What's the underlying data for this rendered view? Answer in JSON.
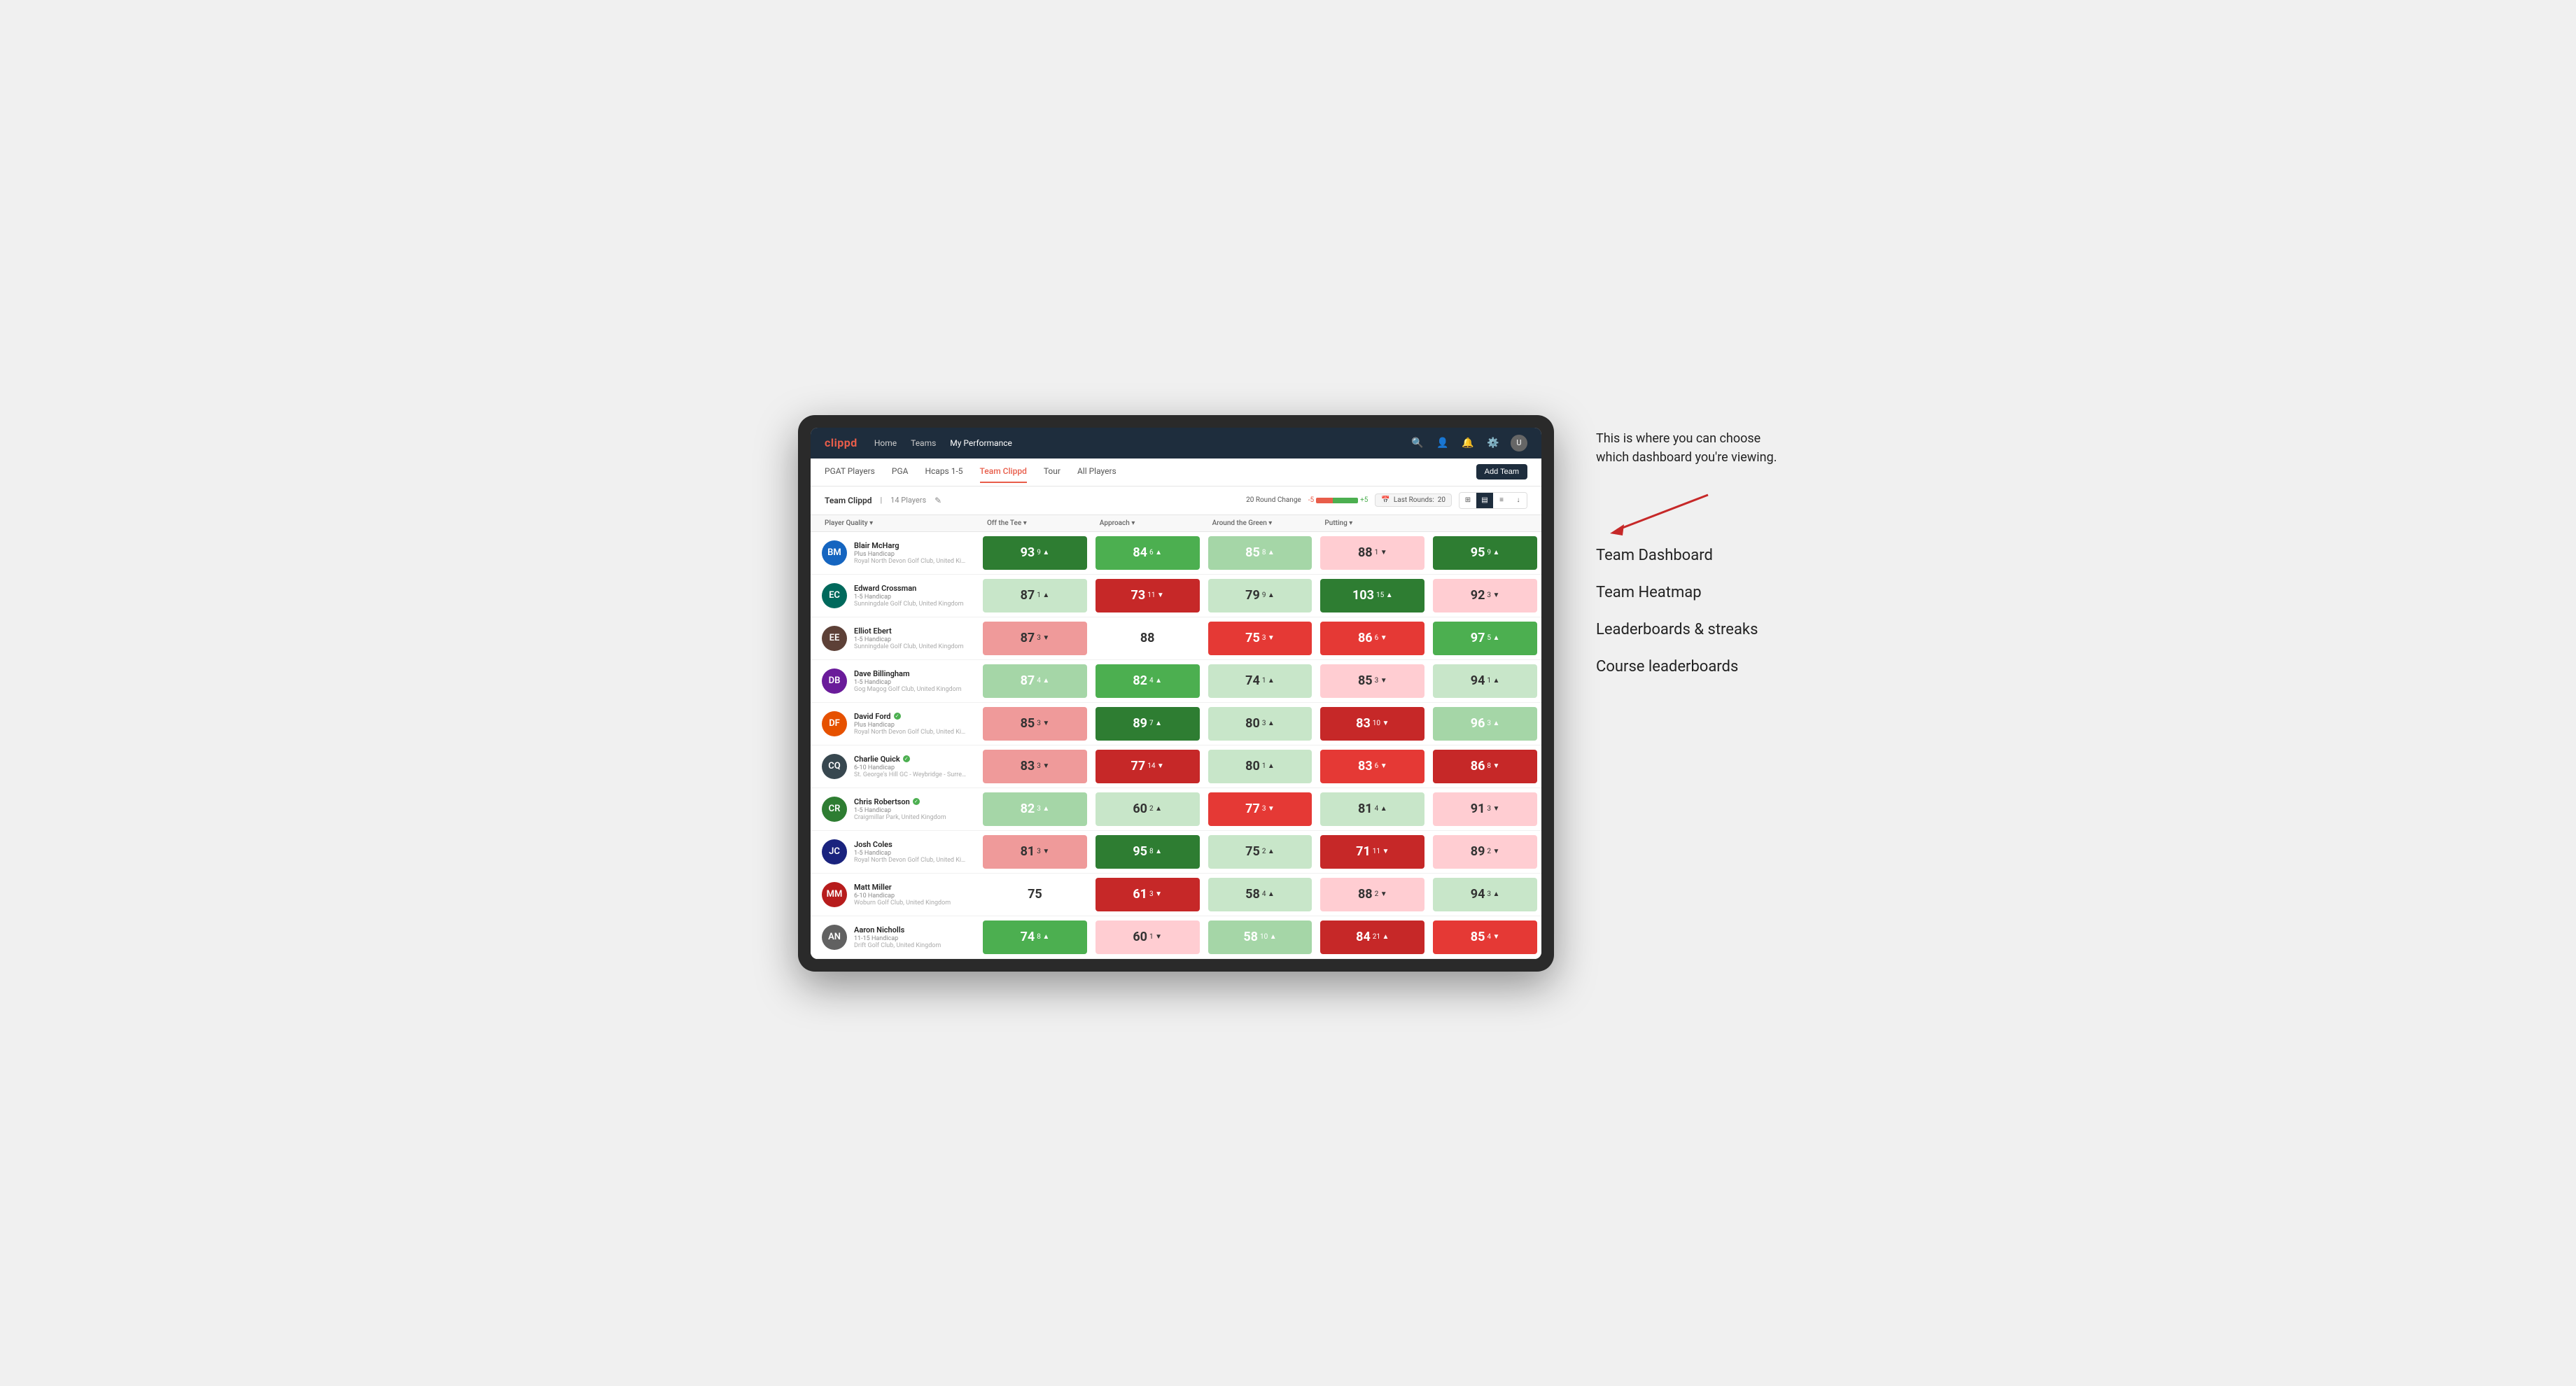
{
  "annotation": {
    "intro": "This is where you can choose which dashboard you're viewing.",
    "arrow": "→"
  },
  "menu": {
    "items": [
      {
        "label": "Team Dashboard"
      },
      {
        "label": "Team Heatmap"
      },
      {
        "label": "Leaderboards & streaks"
      },
      {
        "label": "Course leaderboards"
      }
    ]
  },
  "nav": {
    "logo": "clippd",
    "items": [
      {
        "label": "Home",
        "active": false
      },
      {
        "label": "Teams",
        "active": false
      },
      {
        "label": "My Performance",
        "active": true
      }
    ],
    "add_team": "Add Team"
  },
  "sub_nav": {
    "tabs": [
      {
        "label": "PGAT Players",
        "active": false
      },
      {
        "label": "PGA",
        "active": false
      },
      {
        "label": "Hcaps 1-5",
        "active": false
      },
      {
        "label": "Team Clippd",
        "active": true
      },
      {
        "label": "Tour",
        "active": false
      },
      {
        "label": "All Players",
        "active": false
      }
    ]
  },
  "team_header": {
    "name": "Team Clippd",
    "count": "14 Players",
    "round_change_label": "20 Round Change",
    "neg": "-5",
    "pos": "+5",
    "last_rounds_label": "Last Rounds:",
    "last_rounds_value": "20"
  },
  "table": {
    "headers": [
      {
        "label": "Player Quality ▾"
      },
      {
        "label": "Off the Tee ▾"
      },
      {
        "label": "Approach ▾"
      },
      {
        "label": "Around the Green ▾"
      },
      {
        "label": "Putting ▾"
      }
    ],
    "rows": [
      {
        "name": "Blair McHarg",
        "handicap": "Plus Handicap",
        "club": "Royal North Devon Golf Club, United Kingdom",
        "initials": "BM",
        "av_class": "av-blue",
        "scores": [
          {
            "val": "93",
            "sub": "9",
            "dir": "up",
            "bg": "bg-green-dark"
          },
          {
            "val": "84",
            "sub": "6",
            "dir": "up",
            "bg": "bg-green-med"
          },
          {
            "val": "85",
            "sub": "8",
            "dir": "up",
            "bg": "bg-green-light"
          },
          {
            "val": "88",
            "sub": "1",
            "dir": "down",
            "bg": "bg-very-light-red"
          },
          {
            "val": "95",
            "sub": "9",
            "dir": "up",
            "bg": "bg-green-dark"
          }
        ]
      },
      {
        "name": "Edward Crossman",
        "handicap": "1-5 Handicap",
        "club": "Sunningdale Golf Club, United Kingdom",
        "initials": "EC",
        "av_class": "av-teal",
        "scores": [
          {
            "val": "87",
            "sub": "1",
            "dir": "up",
            "bg": "bg-very-light-green"
          },
          {
            "val": "73",
            "sub": "11",
            "dir": "down",
            "bg": "bg-red-dark"
          },
          {
            "val": "79",
            "sub": "9",
            "dir": "up",
            "bg": "bg-very-light-green"
          },
          {
            "val": "103",
            "sub": "15",
            "dir": "up",
            "bg": "bg-green-dark"
          },
          {
            "val": "92",
            "sub": "3",
            "dir": "down",
            "bg": "bg-very-light-red"
          }
        ]
      },
      {
        "name": "Elliot Ebert",
        "handicap": "1-5 Handicap",
        "club": "Sunningdale Golf Club, United Kingdom",
        "initials": "EE",
        "av_class": "av-brown",
        "scores": [
          {
            "val": "87",
            "sub": "3",
            "dir": "down",
            "bg": "bg-red-light"
          },
          {
            "val": "88",
            "sub": "",
            "dir": "none",
            "bg": "bg-white"
          },
          {
            "val": "75",
            "sub": "3",
            "dir": "down",
            "bg": "bg-red-med"
          },
          {
            "val": "86",
            "sub": "6",
            "dir": "down",
            "bg": "bg-red-med"
          },
          {
            "val": "97",
            "sub": "5",
            "dir": "up",
            "bg": "bg-green-med"
          }
        ]
      },
      {
        "name": "Dave Billingham",
        "handicap": "1-5 Handicap",
        "club": "Gog Magog Golf Club, United Kingdom",
        "initials": "DB",
        "av_class": "av-purple",
        "scores": [
          {
            "val": "87",
            "sub": "4",
            "dir": "up",
            "bg": "bg-green-light"
          },
          {
            "val": "82",
            "sub": "4",
            "dir": "up",
            "bg": "bg-green-med"
          },
          {
            "val": "74",
            "sub": "1",
            "dir": "up",
            "bg": "bg-very-light-green"
          },
          {
            "val": "85",
            "sub": "3",
            "dir": "down",
            "bg": "bg-very-light-red"
          },
          {
            "val": "94",
            "sub": "1",
            "dir": "up",
            "bg": "bg-very-light-green"
          }
        ]
      },
      {
        "name": "David Ford",
        "handicap": "Plus Handicap",
        "club": "Royal North Devon Golf Club, United Kingdom",
        "initials": "DF",
        "av_class": "av-orange",
        "verified": true,
        "scores": [
          {
            "val": "85",
            "sub": "3",
            "dir": "down",
            "bg": "bg-red-light"
          },
          {
            "val": "89",
            "sub": "7",
            "dir": "up",
            "bg": "bg-green-dark"
          },
          {
            "val": "80",
            "sub": "3",
            "dir": "up",
            "bg": "bg-very-light-green"
          },
          {
            "val": "83",
            "sub": "10",
            "dir": "down",
            "bg": "bg-red-dark"
          },
          {
            "val": "96",
            "sub": "3",
            "dir": "up",
            "bg": "bg-green-light"
          }
        ]
      },
      {
        "name": "Charlie Quick",
        "handicap": "6-10 Handicap",
        "club": "St. George's Hill GC - Weybridge - Surrey, Uni...",
        "initials": "CQ",
        "av_class": "av-dark",
        "verified": true,
        "scores": [
          {
            "val": "83",
            "sub": "3",
            "dir": "down",
            "bg": "bg-red-light"
          },
          {
            "val": "77",
            "sub": "14",
            "dir": "down",
            "bg": "bg-red-dark"
          },
          {
            "val": "80",
            "sub": "1",
            "dir": "up",
            "bg": "bg-very-light-green"
          },
          {
            "val": "83",
            "sub": "6",
            "dir": "down",
            "bg": "bg-red-med"
          },
          {
            "val": "86",
            "sub": "8",
            "dir": "down",
            "bg": "bg-red-dark"
          }
        ]
      },
      {
        "name": "Chris Robertson",
        "handicap": "1-5 Handicap",
        "club": "Craigmillar Park, United Kingdom",
        "initials": "CR",
        "av_class": "av-green",
        "verified": true,
        "scores": [
          {
            "val": "82",
            "sub": "3",
            "dir": "up",
            "bg": "bg-green-light"
          },
          {
            "val": "60",
            "sub": "2",
            "dir": "up",
            "bg": "bg-very-light-green"
          },
          {
            "val": "77",
            "sub": "3",
            "dir": "down",
            "bg": "bg-red-med"
          },
          {
            "val": "81",
            "sub": "4",
            "dir": "up",
            "bg": "bg-very-light-green"
          },
          {
            "val": "91",
            "sub": "3",
            "dir": "down",
            "bg": "bg-very-light-red"
          }
        ]
      },
      {
        "name": "Josh Coles",
        "handicap": "1-5 Handicap",
        "club": "Royal North Devon Golf Club, United Kingdom",
        "initials": "JC",
        "av_class": "av-navy",
        "scores": [
          {
            "val": "81",
            "sub": "3",
            "dir": "down",
            "bg": "bg-red-light"
          },
          {
            "val": "95",
            "sub": "8",
            "dir": "up",
            "bg": "bg-green-dark"
          },
          {
            "val": "75",
            "sub": "2",
            "dir": "up",
            "bg": "bg-very-light-green"
          },
          {
            "val": "71",
            "sub": "11",
            "dir": "down",
            "bg": "bg-red-dark"
          },
          {
            "val": "89",
            "sub": "2",
            "dir": "down",
            "bg": "bg-very-light-red"
          }
        ]
      },
      {
        "name": "Matt Miller",
        "handicap": "6-10 Handicap",
        "club": "Woburn Golf Club, United Kingdom",
        "initials": "MM",
        "av_class": "av-red",
        "scores": [
          {
            "val": "75",
            "sub": "",
            "dir": "none",
            "bg": "bg-white"
          },
          {
            "val": "61",
            "sub": "3",
            "dir": "down",
            "bg": "bg-red-dark"
          },
          {
            "val": "58",
            "sub": "4",
            "dir": "up",
            "bg": "bg-very-light-green"
          },
          {
            "val": "88",
            "sub": "2",
            "dir": "down",
            "bg": "bg-very-light-red"
          },
          {
            "val": "94",
            "sub": "3",
            "dir": "up",
            "bg": "bg-very-light-green"
          }
        ]
      },
      {
        "name": "Aaron Nicholls",
        "handicap": "11-15 Handicap",
        "club": "Drift Golf Club, United Kingdom",
        "initials": "AN",
        "av_class": "av-gray",
        "scores": [
          {
            "val": "74",
            "sub": "8",
            "dir": "up",
            "bg": "bg-green-med"
          },
          {
            "val": "60",
            "sub": "1",
            "dir": "down",
            "bg": "bg-very-light-red"
          },
          {
            "val": "58",
            "sub": "10",
            "dir": "up",
            "bg": "bg-green-light"
          },
          {
            "val": "84",
            "sub": "21",
            "dir": "up",
            "bg": "bg-red-dark"
          },
          {
            "val": "85",
            "sub": "4",
            "dir": "down",
            "bg": "bg-red-med"
          }
        ]
      }
    ]
  }
}
